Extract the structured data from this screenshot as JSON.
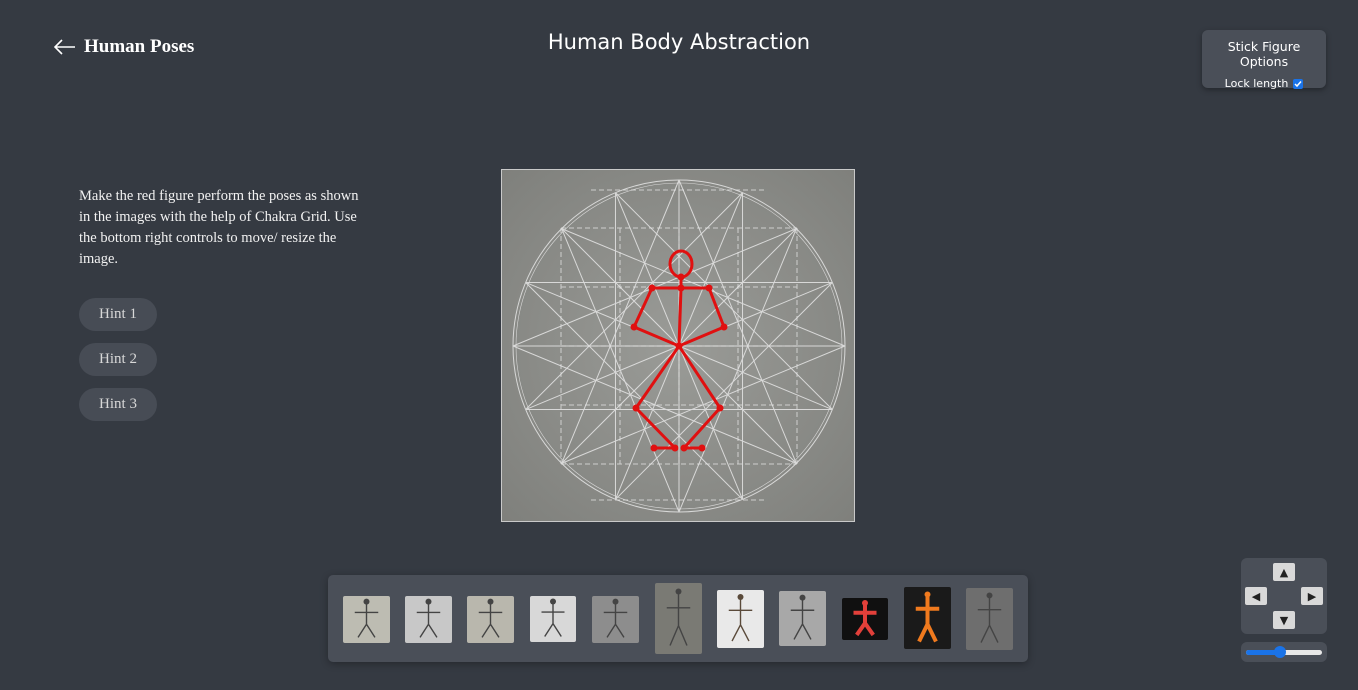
{
  "header": {
    "back_label": "Human Poses",
    "title": "Human Body Abstraction"
  },
  "options": {
    "title": "Stick Figure Options",
    "lock_length_label": "Lock length",
    "lock_length_checked": true
  },
  "instructions": {
    "text": "Make the red figure perform the poses as shown in the images with the help of Chakra Grid. Use the bottom right controls to move/ resize the image."
  },
  "hints": [
    {
      "label": "Hint 1"
    },
    {
      "label": "Hint 2"
    },
    {
      "label": "Hint 3"
    }
  ],
  "canvas": {
    "figure_color": "#e01010",
    "grid_color": "#e6e6e6"
  },
  "gallery": {
    "thumbnails": [
      {
        "name": "chakra-figure-standing",
        "bg": "#bdbcb2"
      },
      {
        "name": "chakra-figure-arms-out",
        "bg": "#c8c8c8"
      },
      {
        "name": "chakra-figure-dancing",
        "bg": "#b9b7ad"
      },
      {
        "name": "chakra-figure-nataraja-sketch",
        "bg": "#d8d8d8"
      },
      {
        "name": "stone-relief-dancer",
        "bg": "#8d8d8d"
      },
      {
        "name": "temple-pillar-carving",
        "bg": "#7a7a74"
      },
      {
        "name": "nataraja-bronze",
        "bg": "#e9e9e9"
      },
      {
        "name": "stone-relief-figures",
        "bg": "#a8a8a8"
      },
      {
        "name": "dancer-red-costume",
        "bg": "#101010"
      },
      {
        "name": "dancer-orange-costume",
        "bg": "#1a1a1a"
      },
      {
        "name": "temple-deity-sculpture",
        "bg": "#6e6e6e"
      }
    ]
  },
  "controls": {
    "up": "▲",
    "down": "▼",
    "left": "◀",
    "right": "▶",
    "zoom_level": 0.45
  }
}
